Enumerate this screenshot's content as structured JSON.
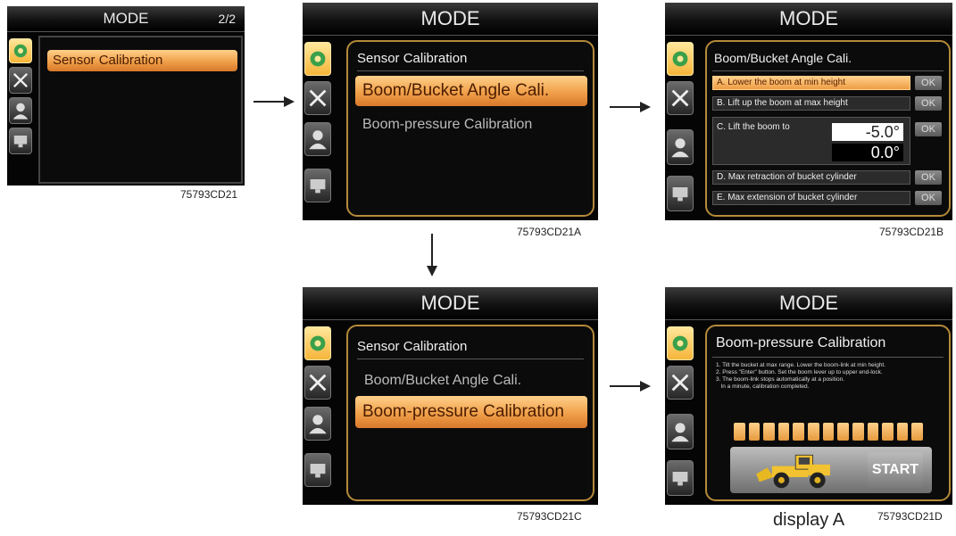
{
  "screens": {
    "s1": {
      "title": "MODE",
      "page_indicator": "2/2",
      "menu_selected": "Sensor Calibration",
      "caption": "75793CD21"
    },
    "s2": {
      "title": "MODE",
      "header": "Sensor Calibration",
      "menu_selected": "Boom/Bucket Angle Cali.",
      "menu_other": "Boom-pressure Calibration",
      "caption": "75793CD21A"
    },
    "s3": {
      "title": "MODE",
      "header": "Boom/Bucket Angle Cali.",
      "steps": [
        {
          "label": "A. Lower the boom at min height",
          "button": "OK"
        },
        {
          "label": "B. Lift up the boom at max height",
          "button": "OK"
        },
        {
          "label": "C. Lift the boom to",
          "button": "OK"
        },
        {
          "label": "D. Max retraction of bucket cylinder",
          "button": "OK"
        },
        {
          "label": "E. Max extension of bucket cylinder",
          "button": "OK"
        }
      ],
      "target_value": "-5.0°",
      "current_value": "0.0°",
      "caption": "75793CD21B"
    },
    "s4": {
      "title": "MODE",
      "header": "Sensor Calibration",
      "menu_other": "Boom/Bucket Angle Cali.",
      "menu_selected": "Boom-pressure Calibration",
      "caption": "75793CD21C"
    },
    "s5": {
      "title": "MODE",
      "header": "Boom-pressure Calibration",
      "instructions": "1. Tilt the bucket at max range. Lower the boom-link at min height.\n2. Press \"Enter\" button. Set the boom lever up to upper end-lock.\n3. The boom-link stops automatically at a position.\n   In a minute, calibration completed.",
      "progress_segments": 13,
      "start_label": "START",
      "caption": "75793CD21D",
      "display_label": "display A"
    }
  },
  "icons": [
    "gear-icon",
    "wrench-screwdriver-icon",
    "user-icon",
    "monitor-icon"
  ],
  "colors": {
    "accent": "#f0a04a",
    "panel_border": "#b58a3a",
    "screen_bg": "#050505"
  }
}
